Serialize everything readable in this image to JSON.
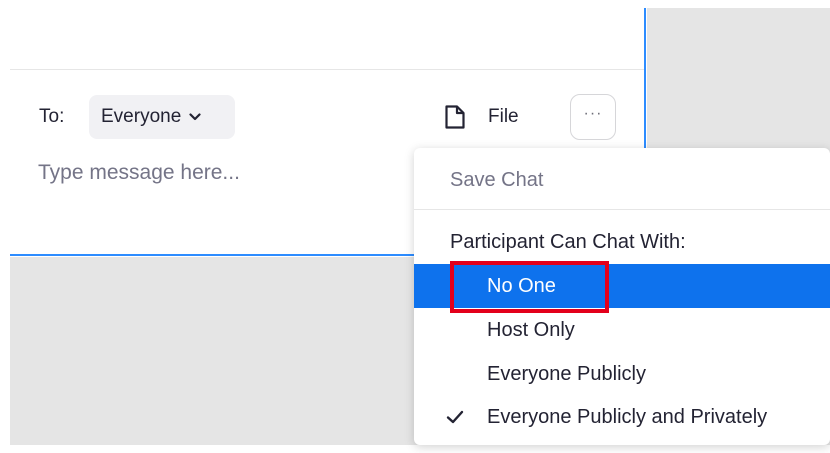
{
  "composer": {
    "to_label": "To:",
    "recipient": "Everyone",
    "file_label": "File",
    "more_label": "···",
    "message_placeholder": "Type message here..."
  },
  "menu": {
    "save_chat": "Save Chat",
    "section_label": "Participant Can Chat With:",
    "options": [
      {
        "label": "No One",
        "selected": false,
        "highlighted": true
      },
      {
        "label": "Host Only",
        "selected": false
      },
      {
        "label": "Everyone Publicly",
        "selected": false
      },
      {
        "label": "Everyone Publicly and Privately",
        "selected": true
      }
    ]
  },
  "colors": {
    "accent": "#0e72ed",
    "panel_border": "#2d8cff",
    "annotation": "#e3001b",
    "backdrop": "#e5e5e5"
  },
  "icons": {
    "recipient_dropdown": "chevron-down-icon",
    "file": "file-icon",
    "checked": "check-icon"
  }
}
